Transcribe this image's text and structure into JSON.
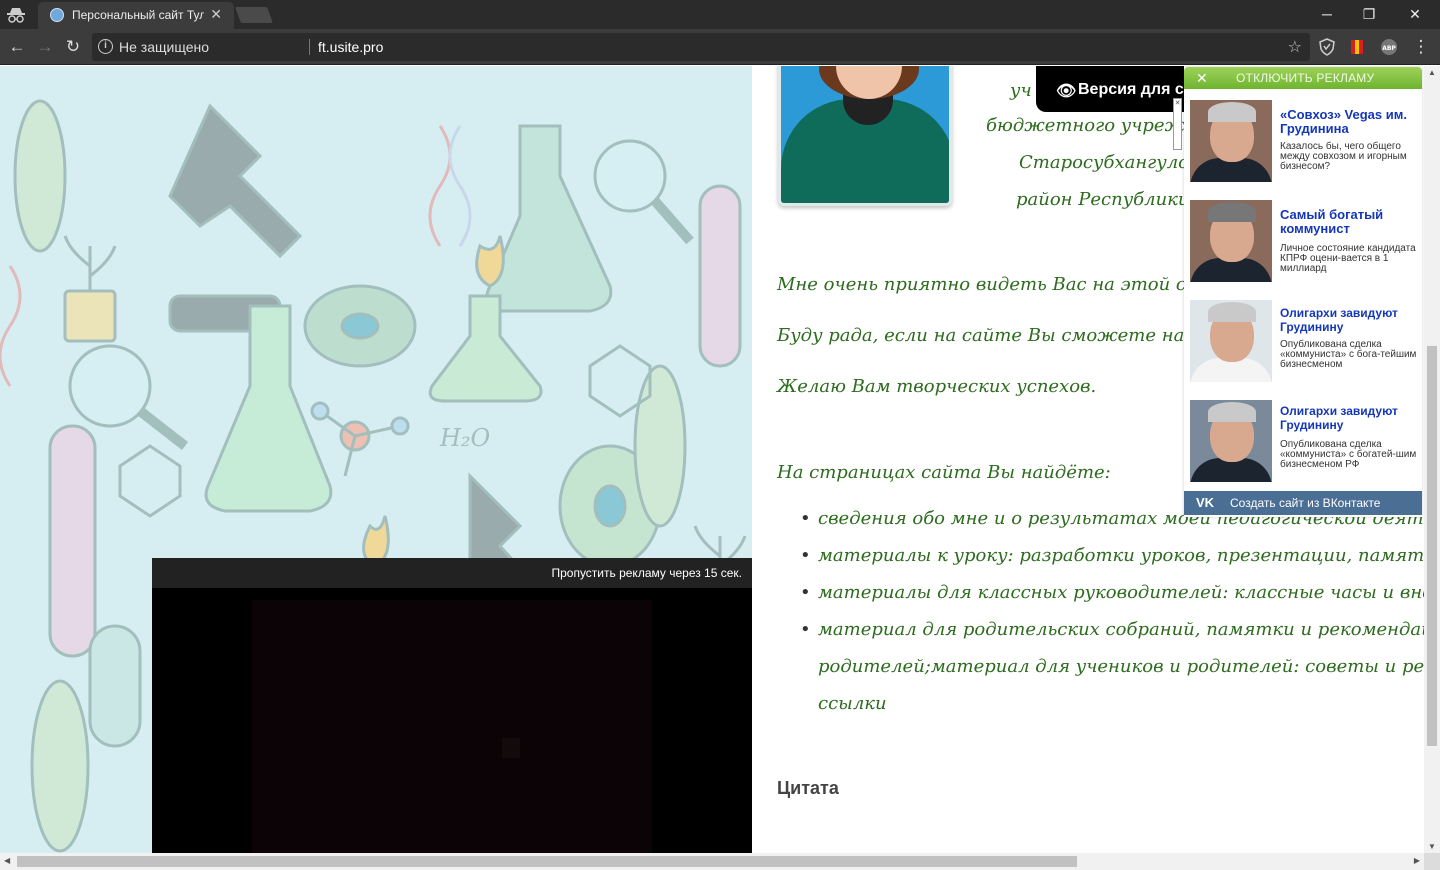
{
  "browser": {
    "tab_title": "Персональный сайт Тул",
    "security_label": "Не защищено",
    "url": "ft.usite.pro"
  },
  "page": {
    "intro_lines": [
      "уч",
      "бюджетного  учрежден",
      "Старосубхангулово",
      "район Республики Б"
    ],
    "paragraphs": [
      "Мне очень приятно видеть Вас на этой страниц",
      "Буду рада, если на сайте Вы сможете найти для",
      "Желаю Вам творческих успехов."
    ],
    "list_heading": "На страницах сайта Вы найдёте:",
    "list_items": [
      "сведения обо мне и о результатах моей педагогической деятельности;",
      "материалы к уроку: разработки уроков, презентации, памятки;",
      "материалы для классных руководителей: классные часы и внеклассные ме",
      "материал для родительских собраний, памятки и рекомендации для",
      "родителей;материал для учеников и родителей: советы и рекомендации, з",
      "ссылки"
    ],
    "quote_title": "Цитата"
  },
  "video_ad": {
    "skip_text": "Пропустить рекламу через 15 сек."
  },
  "version_badge": {
    "label": "Версия для с"
  },
  "ad_panel": {
    "disable_label": "ОТКЛЮЧИТЬ РЕКЛАМУ",
    "items": [
      {
        "title": "«Совхоз» Vegas им. Грудинина",
        "desc": "Казалось бы, чего общего между совхозом и игорным бизнесом?"
      },
      {
        "title": "Самый богатый коммунист",
        "desc": "Личное состояние кандидата КПРФ оцени-вается в 1 миллиард"
      },
      {
        "title": "Олигархи завидуют Грудинину",
        "desc": "Опубликована сделка «коммуниста» с бога-тейшим бизнесменом"
      },
      {
        "title": "Олигархи завидуют Грудинину",
        "desc": "Опубликована сделка «коммуниста» с богатей-шим бизнесменом РФ"
      }
    ],
    "vk_button_label": "Создать сайт из ВКонтакте",
    "vk_logo": "VK"
  },
  "colors": {
    "cursive_text": "#2d6b1e",
    "ad_link": "#1437b8",
    "ad_disable_green": "#6fb42f",
    "vk_blue": "#4a6e94"
  }
}
